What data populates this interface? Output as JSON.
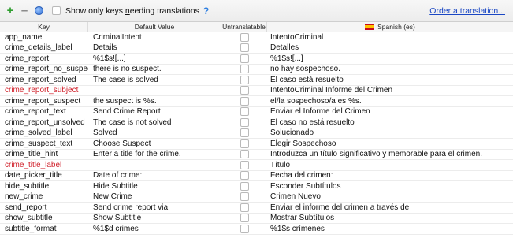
{
  "toolbar": {
    "add_icon": "plus-icon",
    "remove_icon": "minus-icon",
    "globe_icon": "globe-icon",
    "filter_label_pre": "Show only keys ",
    "filter_label_underlined": "n",
    "filter_label_post": "eeding translations",
    "help": "?",
    "order_link": "Order a translation..."
  },
  "columns": {
    "key": "Key",
    "default_value": "Default Value",
    "untranslatable": "Untranslatable",
    "spanish": "Spanish (es)"
  },
  "colors": {
    "missing_key": "#d0202a",
    "link": "#1a47c4",
    "add": "#2e9e2e"
  },
  "rows": [
    {
      "key": "app_name",
      "default": "CriminalIntent",
      "spanish": "IntentoCriminal",
      "missing": false
    },
    {
      "key": "crime_details_label",
      "default": "Details",
      "spanish": "Detalles",
      "missing": false
    },
    {
      "key": "crime_report",
      "default": "%1$s![...]",
      "spanish": "%1$s![...]",
      "missing": false
    },
    {
      "key": "crime_report_no_suspect",
      "default": "there is no suspect.",
      "spanish": "no hay sospechoso.",
      "missing": false
    },
    {
      "key": "crime_report_solved",
      "default": "The case is solved",
      "spanish": "El caso está resuelto",
      "missing": false
    },
    {
      "key": "crime_report_subject",
      "default": "",
      "spanish": "IntentoCriminal Informe del Crimen",
      "missing": true
    },
    {
      "key": "crime_report_suspect",
      "default": "the suspect is %s.",
      "spanish": "el/la sospechoso/a es %s.",
      "missing": false
    },
    {
      "key": "crime_report_text",
      "default": "Send Crime Report",
      "spanish": "Enviar el Informe del Crimen",
      "missing": false
    },
    {
      "key": "crime_report_unsolved",
      "default": "The case is not solved",
      "spanish": "El caso no está resuelto",
      "missing": false
    },
    {
      "key": "crime_solved_label",
      "default": "Solved",
      "spanish": "Solucionado",
      "missing": false
    },
    {
      "key": "crime_suspect_text",
      "default": "Choose Suspect",
      "spanish": "Elegir Sospechoso",
      "missing": false
    },
    {
      "key": "crime_title_hint",
      "default": "Enter a title for the crime.",
      "spanish": "Introduzca un título significativo y memorable para el crimen.",
      "missing": false
    },
    {
      "key": "crime_title_label",
      "default": "",
      "spanish": "Título",
      "missing": true
    },
    {
      "key": "date_picker_title",
      "default": "Date of crime:",
      "spanish": "Fecha del crimen:",
      "missing": false
    },
    {
      "key": "hide_subtitle",
      "default": "Hide Subtitle",
      "spanish": "Esconder Subtítulos",
      "missing": false
    },
    {
      "key": "new_crime",
      "default": "New Crime",
      "spanish": "Crimen Nuevo",
      "missing": false
    },
    {
      "key": "send_report",
      "default": "Send crime report via",
      "spanish": "Enviar el informe del crimen a través de",
      "missing": false
    },
    {
      "key": "show_subtitle",
      "default": "Show Subtitle",
      "spanish": "Mostrar Subtítulos",
      "missing": false
    },
    {
      "key": "subtitle_format",
      "default": "%1$d crimes",
      "spanish": "%1$s crímenes",
      "missing": false
    }
  ]
}
